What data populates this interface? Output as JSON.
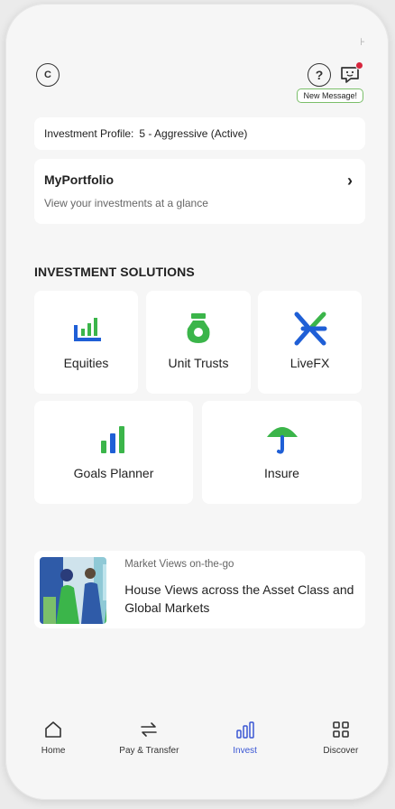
{
  "header": {
    "back_label": "C",
    "help_label": "?",
    "tooltip": "New Message!"
  },
  "profile": {
    "label": "Investment Profile:",
    "value": "5 - Aggressive (Active)"
  },
  "portfolio": {
    "title": "MyPortfolio",
    "subtitle": "View your investments at a glance"
  },
  "section_title": "INVESTMENT SOLUTIONS",
  "tiles": [
    {
      "label": "Equities",
      "icon": "bar-chart-icon",
      "color": "#1f5fd6"
    },
    {
      "label": "Unit Trusts",
      "icon": "money-bag-icon",
      "color": "#3bb54a"
    },
    {
      "label": "LiveFX",
      "icon": "fx-arrows-icon",
      "color": "#1f5fd6"
    },
    {
      "label": "Goals Planner",
      "icon": "growth-bars-icon",
      "color": "#3bb54a"
    },
    {
      "label": "Insure",
      "icon": "umbrella-icon",
      "color": "#3bb54a"
    }
  ],
  "promo": {
    "kicker": "Market Views on-the-go",
    "headline": "House Views across the Asset Class and Global Markets"
  },
  "tabbar": [
    {
      "label": "Home",
      "icon": "home-icon",
      "active": false
    },
    {
      "label": "Pay & Transfer",
      "icon": "transfer-icon",
      "active": false
    },
    {
      "label": "Invest",
      "icon": "invest-icon",
      "active": true
    },
    {
      "label": "Discover",
      "icon": "grid-icon",
      "active": false
    }
  ],
  "colors": {
    "accent_blue": "#3a56d4",
    "brand_green": "#3bb54a",
    "brand_blue": "#1f5fd6",
    "notification_red": "#d7263d"
  }
}
